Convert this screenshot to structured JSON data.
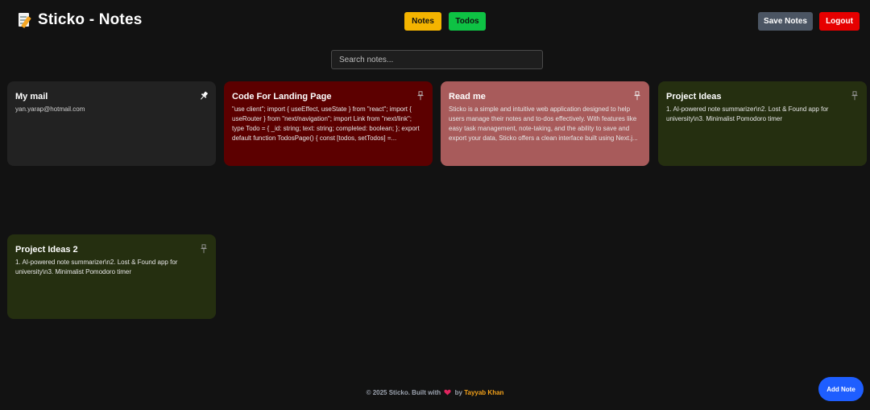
{
  "header": {
    "title": "Sticko - Notes",
    "icon": "memo-icon",
    "nav": {
      "notes_label": "Notes",
      "todos_label": "Todos"
    },
    "actions": {
      "save_label": "Save Notes",
      "logout_label": "Logout"
    }
  },
  "search": {
    "placeholder": "Search notes...",
    "value": ""
  },
  "notes": [
    {
      "title": "My mail",
      "body": "yan.yarap@hotmail.com",
      "pinned": true,
      "color": "#222222"
    },
    {
      "title": "Code For Landing Page",
      "body": "\"use client\"; import { useEffect, useState } from \"react\"; import { useRouter } from \"next/navigation\"; import Link from \"next/link\"; type Todo = { _id: string; text: string; completed: boolean; }; export default function TodosPage() { const [todos, setTodos] =...",
      "pinned": false,
      "color": "#5c0000"
    },
    {
      "title": "Read me",
      "body": "Sticko is a simple and intuitive web application designed to help users manage their notes and to-dos effectively. With features like easy task management, note-taking, and the ability to save and export your data, Sticko offers a clean interface built using Next.j...",
      "pinned": false,
      "color": "#a85b5b"
    },
    {
      "title": "Project Ideas",
      "body": "1. AI-powered note summarizer\\n2. Lost & Found app for university\\n3. Minimalist Pomodoro timer",
      "pinned": false,
      "color": "#252f10"
    },
    {
      "title": "Project Ideas 2",
      "body": "1. AI-powered note summarizer\\n2. Lost & Found app for university\\n3. Minimalist Pomodoro timer",
      "pinned": false,
      "color": "#252f10"
    }
  ],
  "footer": {
    "prefix": "© 2025 Sticko. Built with",
    "by": "by",
    "author": "Tayyab Khan",
    "heart_color": "#e0245e",
    "author_color": "#f4a21a"
  },
  "add_note": {
    "label": "Add Note",
    "color": "#1e5eff"
  },
  "colors": {
    "notes_btn": "#f4b400",
    "todos_btn": "#0ec244",
    "save_btn": "#4b5563",
    "logout_btn": "#e60000",
    "background": "#121212"
  }
}
